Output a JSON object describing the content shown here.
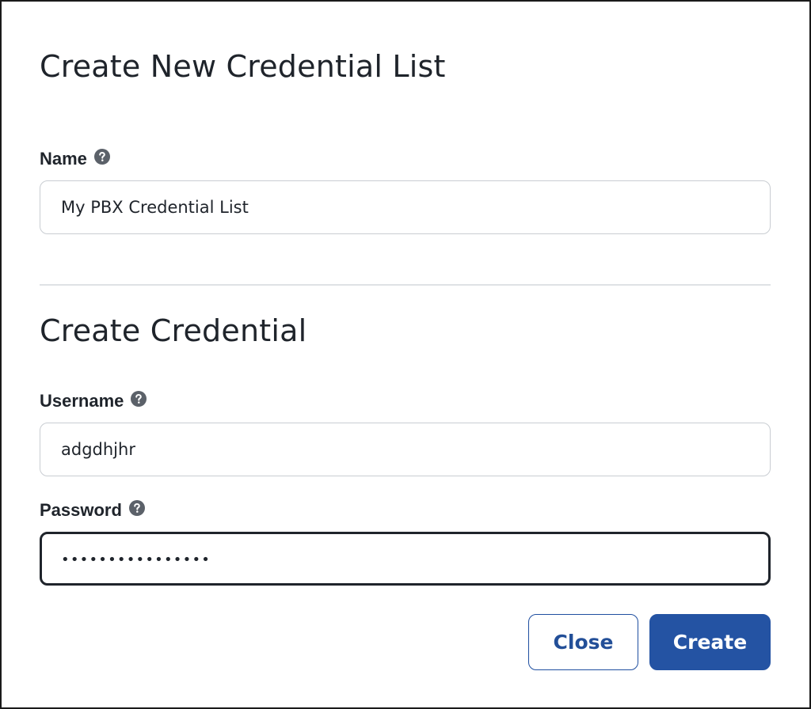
{
  "dialog": {
    "title": "Create New Credential List"
  },
  "credential_list": {
    "name_label": "Name",
    "name_value": "My PBX Credential List"
  },
  "credential": {
    "section_title": "Create Credential",
    "username_label": "Username",
    "username_value": "adgdhjhr",
    "password_label": "Password",
    "password_masked": "••••••••••••••••"
  },
  "actions": {
    "close_label": "Close",
    "create_label": "Create"
  },
  "icons": {
    "help": "question-circle-icon"
  },
  "colors": {
    "primary": "#2453a3",
    "text": "#1f242b",
    "border": "#c9cdd2",
    "help_icon": "#5b6169"
  }
}
